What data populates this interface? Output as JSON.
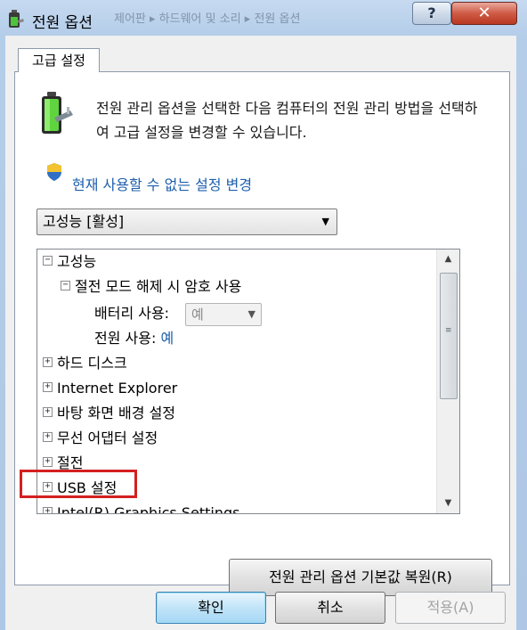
{
  "window": {
    "title": "전원 옵션",
    "behind_breadcrumb": "제어판 ▸ 하드웨어 및 소리 ▸ 전원 옵션",
    "help_glyph": "?",
    "close_glyph": "✕"
  },
  "tab": {
    "label": "고급 설정"
  },
  "description": "전원 관리 옵션을 선택한 다음 컴퓨터의 전원 관리 방법을 선택하여 고급 설정을 변경할 수 있습니다.",
  "change_link": "현재 사용할 수 없는 설정 변경",
  "plan": {
    "selected": "고성능 [활성]"
  },
  "tree": {
    "root": "고성능",
    "password": "절전 모드 해제 시 암호 사용",
    "battery_label": "배터리 사용:",
    "battery_value": "예",
    "power_label": "전원 사용:",
    "power_value": "예",
    "hard_disk": "하드 디스크",
    "ie": "Internet Explorer",
    "desktop_bg": "바탕 화면 배경 설정",
    "wireless": "무선 어댑터 설정",
    "sleep": "절전",
    "usb": "USB 설정",
    "intel_partial": "Intel(R) Graphics Settings"
  },
  "buttons": {
    "restore": "전원 관리 옵션 기본값 복원(R)",
    "ok": "확인",
    "cancel": "취소",
    "apply": "적용(A)"
  },
  "colors": {
    "highlight": "#d42020",
    "link": "#1e5fad"
  }
}
